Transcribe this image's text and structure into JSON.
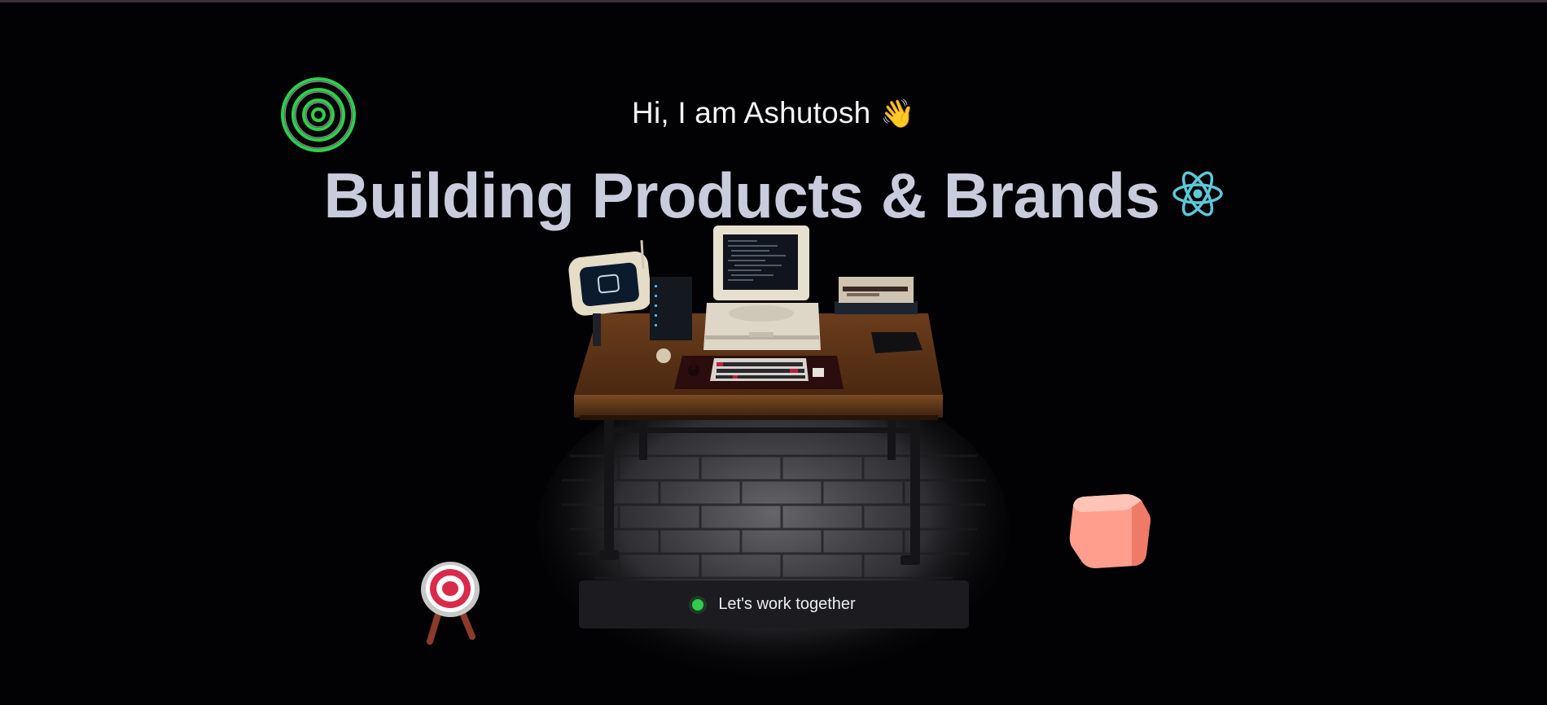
{
  "hero": {
    "greeting": "Hi, I am Ashutosh",
    "wave_emoji": "👋",
    "headline": "Building Products & Brands"
  },
  "cta": {
    "label": "Let's work together",
    "status_color": "#2ecc4f"
  },
  "icons": {
    "react": "react-logo-icon",
    "rings": "concentric-rings-icon",
    "target": "target-icon",
    "cube": "cube-icon"
  },
  "colors": {
    "background": "#020204",
    "headline": "#c9ccdc",
    "react_accent": "#5ec8d8",
    "rings_accent": "#2bd14a",
    "cube_accent": "#ff9c8a"
  }
}
